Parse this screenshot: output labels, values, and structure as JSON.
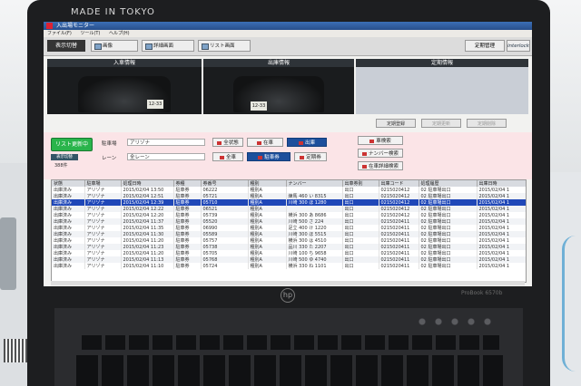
{
  "bezel_brand": "MADE IN TOKYO",
  "laptop_logo": "hp",
  "laptop_model": "ProBook 6570b",
  "window": {
    "title": "入出場モニター"
  },
  "menu": [
    "ファイル(F)",
    "ツール(T)",
    "ヘルプ(H)"
  ],
  "toolbar": {
    "mode_label": "表示切替",
    "buttons": [
      "画像",
      "詳細画面",
      "リスト画面"
    ],
    "right_label": "定期管理",
    "brand": "interlock"
  },
  "panels": {
    "entry": "入車情報",
    "exit": "出庫情報",
    "pass": "定期情報"
  },
  "plates": {
    "entry": "12-33",
    "exit": "12-33"
  },
  "panel_buttons": [
    "定期登録",
    "定期更新",
    "定期削除"
  ],
  "filters": {
    "list_update": "リスト更新中",
    "small_button": "表示切替",
    "count": "388件",
    "parking_label": "駐車場",
    "parking_value": "アリゾナ",
    "lane_label": "レーン",
    "lane_value": "全レーン",
    "group1": [
      "全状態",
      "在車",
      "出庫"
    ],
    "group2": [
      "全車",
      "駐車券",
      "定期券"
    ],
    "actions": [
      "車検索",
      "ナンバー検索",
      "在車詳細検索"
    ]
  },
  "table": {
    "columns": [
      "状態",
      "駐車場",
      "処理日時",
      "券種",
      "券番号",
      "種別",
      "ナンバー",
      "出車券別",
      "出庫コード",
      "処理履歴",
      "出庫日時"
    ],
    "selected_index": 2,
    "rows": [
      [
        "出庫済み",
        "アリゾナ",
        "2015/02/04 13:50",
        "駐車券",
        "06222",
        "種別A",
        "",
        "出口",
        "0215020412",
        "02 駐車場出口",
        "2015/02/04 1"
      ],
      [
        "出庫済み",
        "アリゾナ",
        "2015/02/04 12:51",
        "駐車券",
        "05721",
        "種別A",
        "練馬 460 い 8315",
        "出口",
        "0215020412",
        "02 駐車場出口",
        "2015/02/04 1"
      ],
      [
        "出庫済み",
        "アリゾナ",
        "2015/02/04 12:39",
        "駐車券",
        "05710",
        "種別A",
        "川崎 300 ほ 1280",
        "出口",
        "0215020412",
        "02 駐車場出口",
        "2015/02/04 1"
      ],
      [
        "出庫済み",
        "アリゾナ",
        "2015/02/04 12:22",
        "駐車券",
        "06521",
        "種別A",
        "",
        "出口",
        "0215020412",
        "02 駐車場出口",
        "2015/02/04 1"
      ],
      [
        "出庫済み",
        "アリゾナ",
        "2015/02/04 12:20",
        "駐車券",
        "05739",
        "種別A",
        "横浜 300 あ 8686",
        "出口",
        "0215020412",
        "02 駐車場出口",
        "2015/02/04 1"
      ],
      [
        "出庫済み",
        "アリゾナ",
        "2015/02/04 11:37",
        "駐車券",
        "05520",
        "種別A",
        "川崎 500 さ 224",
        "出口",
        "0215020411",
        "02 駐車場出口",
        "2015/02/04 1"
      ],
      [
        "出庫済み",
        "アリゾナ",
        "2015/02/04 11:35",
        "駐車券",
        "06990",
        "種別A",
        "足立 400 け 1220",
        "出口",
        "0215020411",
        "02 駐車場出口",
        "2015/02/04 1"
      ],
      [
        "出庫済み",
        "アリゾナ",
        "2015/02/04 11:30",
        "駐車券",
        "05589",
        "種別A",
        "川崎 300 ほ 5515",
        "出口",
        "0215020411",
        "02 駐車場出口",
        "2015/02/04 1"
      ],
      [
        "出庫済み",
        "アリゾナ",
        "2015/02/04 11:20",
        "駐車券",
        "05757",
        "種別A",
        "横浜 300 は 4510",
        "出口",
        "0215020411",
        "02 駐車場出口",
        "2015/02/04 1"
      ],
      [
        "出庫済み",
        "アリゾナ",
        "2015/02/04 11:23",
        "駐車券",
        "05738",
        "種別A",
        "品川 330 た 2207",
        "出口",
        "0215020411",
        "02 駐車場出口",
        "2015/02/04 1"
      ],
      [
        "出庫済み",
        "アリゾナ",
        "2015/02/04 11:20",
        "駐車券",
        "05705",
        "種別A",
        "川崎 100 ち 9658",
        "出口",
        "0215020411",
        "02 駐車場出口",
        "2015/02/04 1"
      ],
      [
        "出庫済み",
        "アリゾナ",
        "2015/02/04 11:13",
        "駐車券",
        "05768",
        "種別A",
        "川崎 500 ゆ 4740",
        "出口",
        "0215020411",
        "02 駐車場出口",
        "2015/02/04 1"
      ],
      [
        "出庫済み",
        "アリゾナ",
        "2015/02/04 11:10",
        "駐車券",
        "05724",
        "種別A",
        "横浜 330 ね 1101",
        "出口",
        "0215020411",
        "02 駐車場出口",
        "2015/02/04 1"
      ]
    ]
  }
}
